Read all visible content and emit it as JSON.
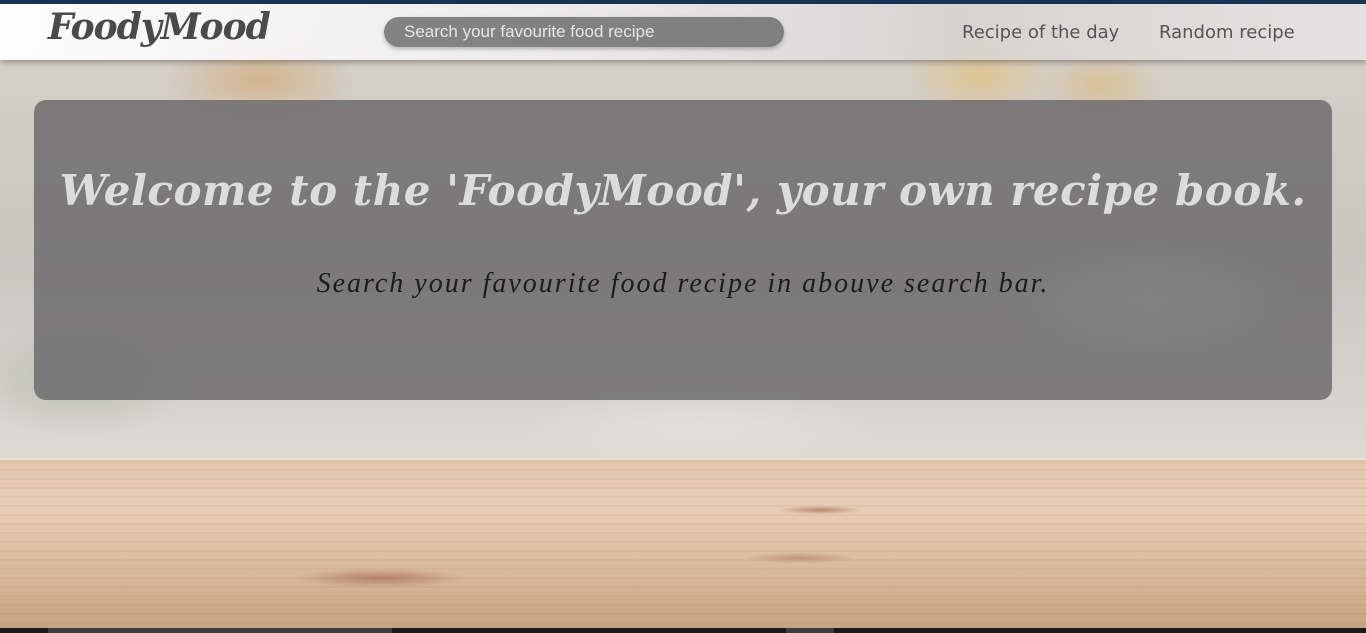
{
  "brand": {
    "name": "FoodyMood"
  },
  "search": {
    "placeholder": "Search your favourite food recipe",
    "value": ""
  },
  "nav": {
    "items": [
      {
        "label": "Recipe of the day"
      },
      {
        "label": "Random recipe"
      }
    ]
  },
  "hero": {
    "title": "Welcome to the 'FoodyMood', your own recipe book.",
    "subtitle": "Search your favourite food recipe in abouve search bar."
  },
  "colors": {
    "topline": "#16365a",
    "hero_panel": "#696969",
    "logo_text": "#4a4a4a"
  }
}
